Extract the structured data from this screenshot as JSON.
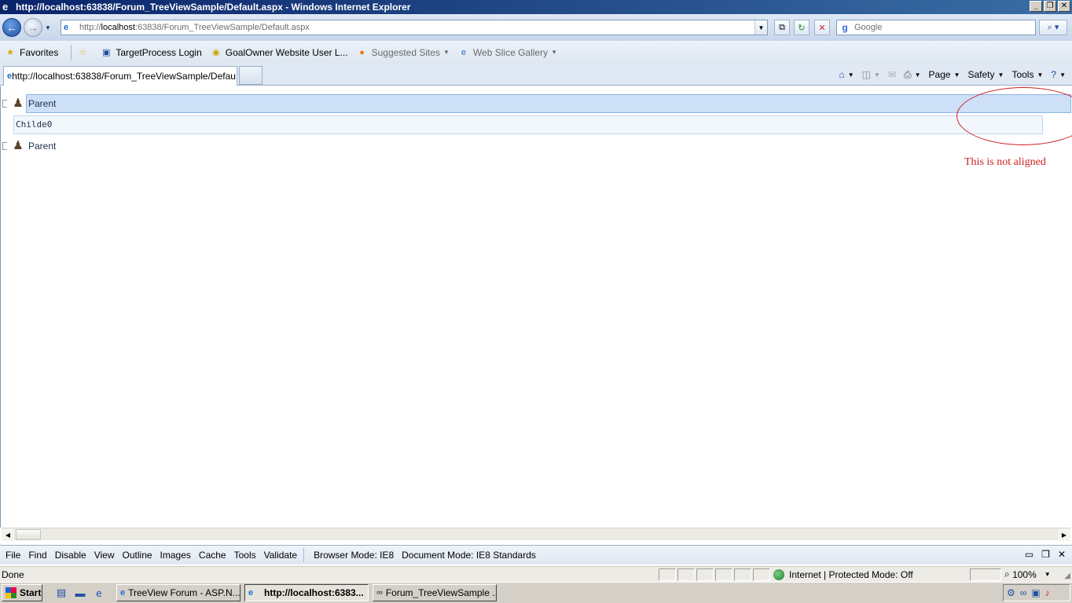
{
  "window": {
    "title": "http://localhost:63838/Forum_TreeViewSample/Default.aspx - Windows Internet Explorer"
  },
  "address_bar": {
    "url_prefix": "http://",
    "url_host": "localhost",
    "url_rest": ":63838/Forum_TreeViewSample/Default.aspx"
  },
  "search": {
    "placeholder": "Google"
  },
  "favorites_bar": {
    "favorites_label": "Favorites",
    "items": [
      {
        "label": "TargetProcess  Login"
      },
      {
        "label": "GoalOwner Website  User L..."
      },
      {
        "label": "Suggested Sites"
      },
      {
        "label": "Web Slice Gallery"
      }
    ]
  },
  "tabs": [
    {
      "label": "http://localhost:63838/Forum_TreeViewSample/Defau..."
    }
  ],
  "command_bar": {
    "page": "Page",
    "safety": "Safety",
    "tools": "Tools"
  },
  "tree": {
    "nodes": [
      {
        "label": "Parent",
        "selected": true
      },
      {
        "label": "Childe0"
      },
      {
        "label": "Parent"
      }
    ]
  },
  "annotation": {
    "text": "This is not aligned",
    "color": "#cc2222"
  },
  "dev_toolbar": {
    "items": [
      "File",
      "Find",
      "Disable",
      "View",
      "Outline",
      "Images",
      "Cache",
      "Tools",
      "Validate"
    ],
    "browser_mode": "Browser Mode:  IE8",
    "document_mode": "Document Mode:  IE8 Standards"
  },
  "status_bar": {
    "status": "Done",
    "zone": "Internet | Protected Mode: Off",
    "zoom": "100%"
  },
  "taskbar": {
    "start": "Start",
    "buttons": [
      {
        "label": "TreeView Forum - ASP.N...",
        "active": false
      },
      {
        "label": "http://localhost:6383...",
        "active": true
      },
      {
        "label": "Forum_TreeViewSample ...",
        "active": false
      }
    ]
  },
  "colors": {
    "selection": "#cde0f7",
    "title_bar": "#0a246a"
  }
}
